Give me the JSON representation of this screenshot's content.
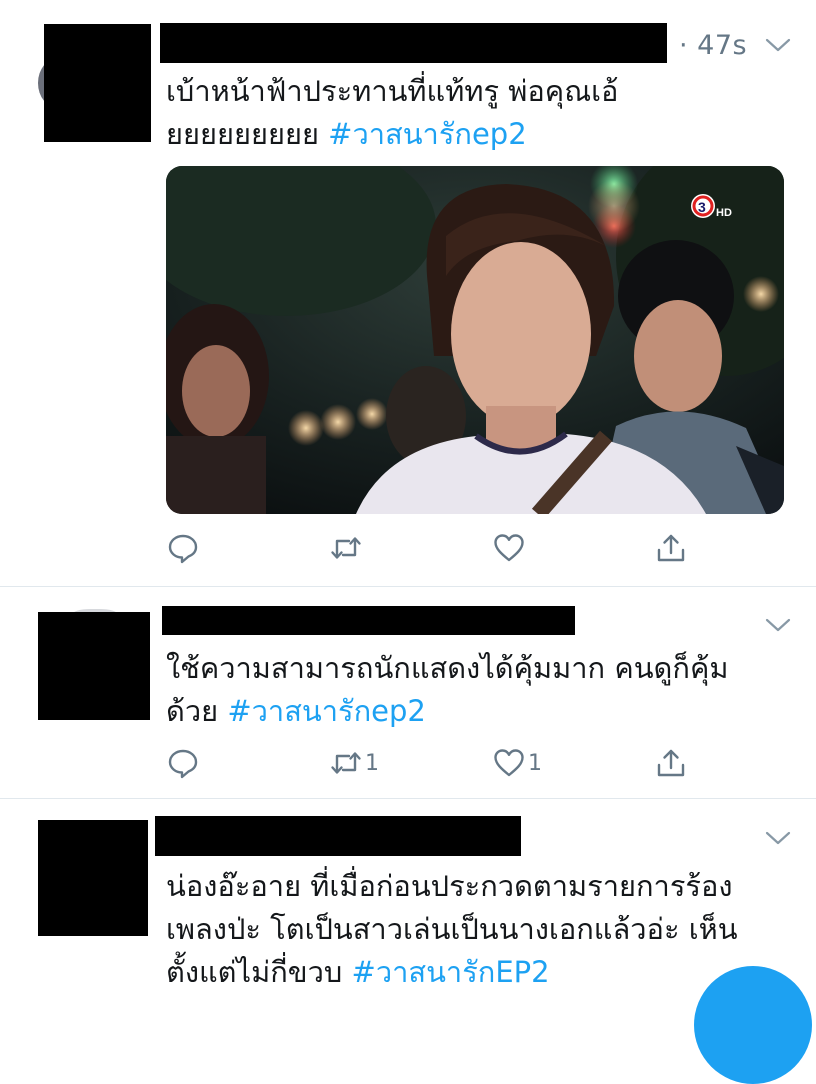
{
  "tweets": [
    {
      "timestamp": "· 47s",
      "text": "เบ้าหน้าฟ้าประทานที่แท้ทรู พ่อคุณเอ้",
      "text_line2": "ยยยยยยยยย ",
      "hashtag": "#วาสนารักep2",
      "media": {
        "channel_logo": "3",
        "channel_badge": "HD"
      },
      "actions": {
        "reply": "",
        "retweet": "",
        "like": ""
      }
    },
    {
      "text": "ใช้ความสามารถนักแสดงได้คุ้มมาก คนดูก็คุ้ม",
      "text_line2": "ด้วย ",
      "hashtag": "#วาสนารักep2",
      "actions": {
        "reply": "",
        "retweet": "1",
        "like": "1"
      }
    },
    {
      "text": "น่องอ๊ะอาย ที่เมื่อก่อนประกวดตามรายการร้อง",
      "text_line2": "เพลงป่ะ โตเป็นสาวเล่นเป็นนางเอกแล้วอ่ะ เห็น",
      "text_line3": "ตั้งแต่ไม่กี่ขวบ ",
      "hashtag": "#วาสนารักEP2"
    }
  ],
  "colors": {
    "accent": "#1da1f2",
    "muted": "#657786",
    "text": "#14171a",
    "divider": "#e1e8ed"
  }
}
